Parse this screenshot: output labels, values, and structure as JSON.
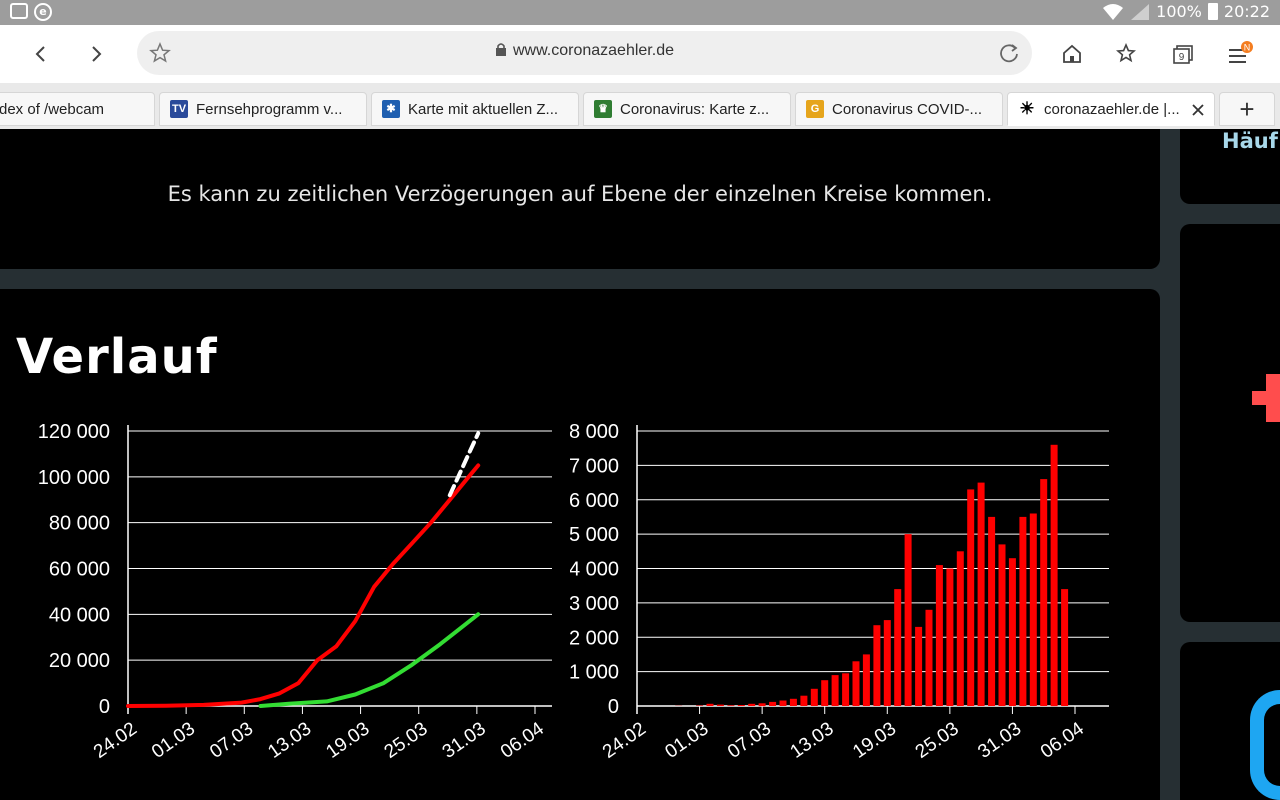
{
  "statusbar": {
    "battery": "100%",
    "time": "20:22"
  },
  "browser": {
    "url": "www.coronazaehler.de",
    "menu_badge": "N",
    "tab_count": "9",
    "new_tab": "+"
  },
  "tabs": [
    {
      "label": "dex of /webcam"
    },
    {
      "label": "Fernsehprogramm v..."
    },
    {
      "label": "Karte mit aktuellen Z..."
    },
    {
      "label": "Coronavirus: Karte z..."
    },
    {
      "label": "Coronavirus COVID-..."
    },
    {
      "label": "coronazaehler.de |..."
    }
  ],
  "page": {
    "notice": "Es kann zu zeitlichen Verzögerungen auf Ebene der einzelnen Kreise kommen.",
    "section_title": "Verlauf",
    "side_title": "Häuf"
  },
  "colors": {
    "confirmed": "#ff0000",
    "recovered": "#33dd33",
    "bars": "#ff0000",
    "panel": "#000000",
    "page_bg": "#262f33"
  },
  "chart_data": [
    {
      "type": "line",
      "x_ticks": [
        "24.02",
        "01.03",
        "07.03",
        "13.03",
        "19.03",
        "25.03",
        "31.03",
        "06.04"
      ],
      "y_ticks": [
        "0",
        "20 000",
        "40 000",
        "60 000",
        "80 000",
        "100 000",
        "120 000"
      ],
      "ylim": [
        0,
        120000
      ],
      "x_range_days": [
        0,
        43
      ],
      "series": [
        {
          "color": "#ff0000",
          "x": [
            0,
            4,
            8,
            12,
            14,
            16,
            18,
            20,
            22,
            24,
            26,
            28,
            30,
            32,
            34,
            36,
            37
          ],
          "values": [
            16,
            150,
            500,
            1500,
            3000,
            5500,
            10000,
            20000,
            26000,
            37000,
            52000,
            62000,
            71000,
            80000,
            90000,
            100000,
            105000
          ]
        },
        {
          "color": "#33dd33",
          "x": [
            14,
            17,
            21,
            24,
            27,
            30,
            33,
            37
          ],
          "values": [
            0,
            1000,
            2000,
            5000,
            10000,
            18000,
            27000,
            40000
          ]
        },
        {
          "color": "#ffffff",
          "dashed": true,
          "x": [
            34,
            35,
            36,
            37
          ],
          "values": [
            92000,
            101000,
            110000,
            119000
          ]
        }
      ]
    },
    {
      "type": "bar",
      "x_ticks": [
        "24.02",
        "01.03",
        "07.03",
        "13.03",
        "19.03",
        "25.03",
        "31.03",
        "06.04"
      ],
      "y_ticks": [
        "0",
        "1 000",
        "2 000",
        "3 000",
        "4 000",
        "5 000",
        "6 000",
        "7 000",
        "8 000"
      ],
      "ylim": [
        0,
        8000
      ],
      "values": [
        0,
        0,
        0,
        5,
        0,
        15,
        65,
        40,
        20,
        30,
        65,
        80,
        120,
        160,
        210,
        300,
        500,
        750,
        900,
        950,
        1300,
        1500,
        2350,
        2500,
        3400,
        5000,
        2300,
        2800,
        4100,
        4000,
        4500,
        6300,
        6500,
        5500,
        4700,
        4300,
        5500,
        5600,
        6600,
        7600,
        3400
      ]
    }
  ]
}
